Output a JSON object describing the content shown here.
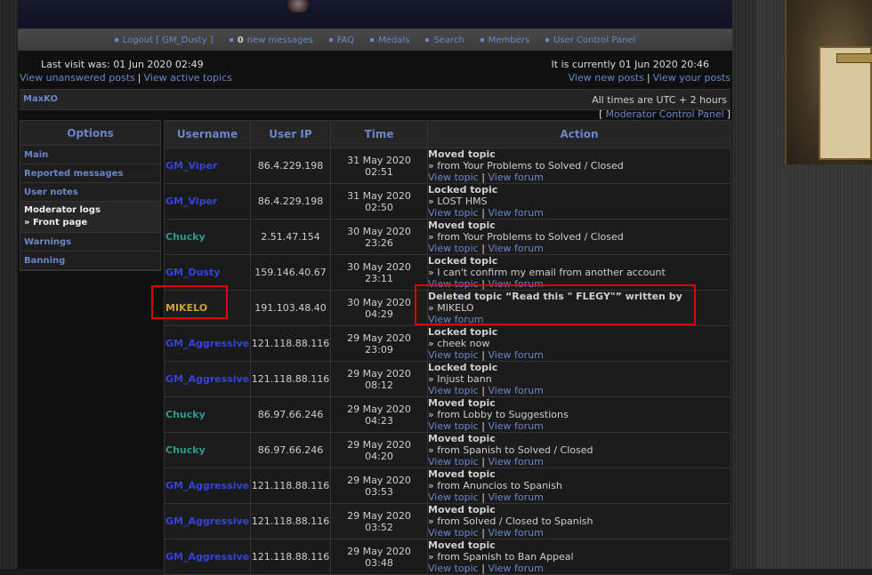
{
  "colors": {
    "link": "#6a86c8",
    "highlight": "#e00000",
    "mod_blue": "#3344dd",
    "mod_green": "#2a9c8c",
    "admin_orange": "#d0a030"
  },
  "nav": {
    "logout": "Logout [ GM_Dusty ]",
    "messages_count": "0",
    "messages_label": "new messages",
    "faq": "FAQ",
    "medals": "Medals",
    "search": "Search",
    "members": "Members",
    "ucp": "User Control Panel"
  },
  "visit": {
    "last_visit": "Last visit was: 01 Jun 2020 02:49",
    "unanswered": "View unanswered posts",
    "active": "View active topics",
    "current_time": "It is currently 01 Jun 2020 20:46",
    "new_posts": "View new posts",
    "your_posts": "View your posts"
  },
  "breadcrumb": {
    "site": "MaxKO",
    "timezone": "All times are UTC + 2 hours"
  },
  "mcp_link": "Moderator Control Panel",
  "options": {
    "title": "Options",
    "items": [
      "Main",
      "Reported messages",
      "User notes"
    ],
    "active_title": "Moderator logs",
    "active_sub": "» Front page",
    "items_after": [
      "Warnings",
      "Banning"
    ]
  },
  "table": {
    "headers": [
      "Username",
      "User IP",
      "Time",
      "Action"
    ],
    "view_topic": "View topic",
    "view_forum": "View forum",
    "rows": [
      {
        "user": "GM_Viper",
        "color": "blue",
        "ip": "86.4.229.198",
        "date": "31 May 2020",
        "time": "02:51",
        "title": "Moved topic",
        "detail": "» from Your Problems to Solved / Closed"
      },
      {
        "user": "GM_Viper",
        "color": "blue",
        "ip": "86.4.229.198",
        "date": "31 May 2020",
        "time": "02:50",
        "title": "Locked topic",
        "detail": "» LOST HMS"
      },
      {
        "user": "Chucky",
        "color": "green",
        "ip": "2.51.47.154",
        "date": "30 May 2020",
        "time": "23:26",
        "title": "Moved topic",
        "detail": "» from Your Problems to Solved / Closed"
      },
      {
        "user": "GM_Dusty",
        "color": "blue",
        "ip": "159.146.40.67",
        "date": "30 May 2020",
        "time": "23:11",
        "title": "Locked topic",
        "detail": "» I can't confirm my email from another account"
      },
      {
        "user": "MIKELO",
        "color": "orange",
        "ip": "191.103.48.40",
        "date": "30 May 2020",
        "time": "04:29",
        "title": "Deleted topic “Read this \" FLEGY\"” written by",
        "detail": "» MIKELO",
        "forum_only": true
      },
      {
        "user": "GM_Aggressive",
        "color": "blue",
        "ip": "121.118.88.116",
        "date": "29 May 2020",
        "time": "23:09",
        "title": "Locked topic",
        "detail": "» cheek now"
      },
      {
        "user": "GM_Aggressive",
        "color": "blue",
        "ip": "121.118.88.116",
        "date": "29 May 2020",
        "time": "08:12",
        "title": "Locked topic",
        "detail": "» Injust bann"
      },
      {
        "user": "Chucky",
        "color": "green",
        "ip": "86.97.66.246",
        "date": "29 May 2020",
        "time": "04:23",
        "title": "Moved topic",
        "detail": "» from Lobby to Suggestions"
      },
      {
        "user": "Chucky",
        "color": "green",
        "ip": "86.97.66.246",
        "date": "29 May 2020",
        "time": "04:20",
        "title": "Moved topic",
        "detail": "» from Spanish to Solved / Closed"
      },
      {
        "user": "GM_Aggressive",
        "color": "blue",
        "ip": "121.118.88.116",
        "date": "29 May 2020",
        "time": "03:53",
        "title": "Moved topic",
        "detail": "» from Anuncios to Spanish"
      },
      {
        "user": "GM_Aggressive",
        "color": "blue",
        "ip": "121.118.88.116",
        "date": "29 May 2020",
        "time": "03:52",
        "title": "Moved topic",
        "detail": "» from Solved / Closed to Spanish"
      },
      {
        "user": "GM_Aggressive",
        "color": "blue",
        "ip": "121.118.88.116",
        "date": "29 May 2020",
        "time": "03:48",
        "title": "Moved topic",
        "detail": "» from Spanish to Ban Appeal"
      }
    ]
  }
}
